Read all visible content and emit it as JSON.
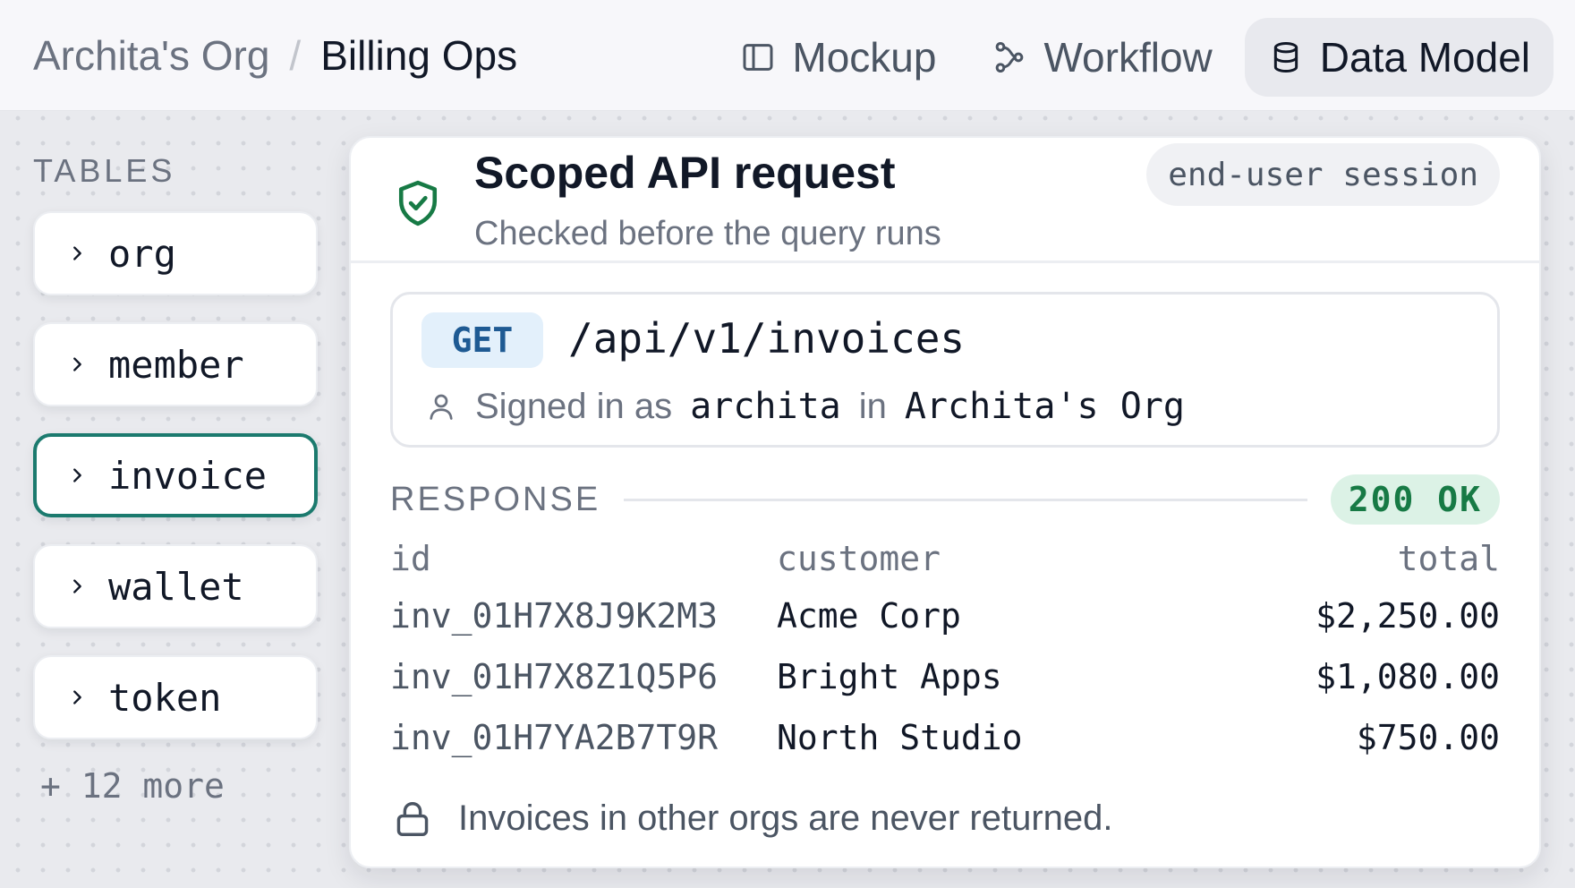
{
  "breadcrumb": {
    "org": "Archita's Org",
    "separator": "/",
    "project": "Billing Ops"
  },
  "nav": {
    "tabs": [
      {
        "label": "Mockup",
        "icon": "panel-icon",
        "active": false
      },
      {
        "label": "Workflow",
        "icon": "workflow-icon",
        "active": false
      },
      {
        "label": "Data Model",
        "icon": "database-icon",
        "active": true
      }
    ]
  },
  "sidebar": {
    "heading": "TABLES",
    "tables": [
      {
        "name": "org",
        "selected": false
      },
      {
        "name": "member",
        "selected": false
      },
      {
        "name": "invoice",
        "selected": true
      },
      {
        "name": "wallet",
        "selected": false
      },
      {
        "name": "token",
        "selected": false
      }
    ],
    "more": "+ 12 more"
  },
  "card": {
    "title": "Scoped API request",
    "subtitle": "Checked before the query runs",
    "session": "end-user session",
    "request": {
      "method": "GET",
      "path": "/api/v1/invoices",
      "signed_prefix": "Signed in as",
      "user": "archita",
      "in_word": "in",
      "org": "Archita's Org"
    },
    "response": {
      "label": "RESPONSE",
      "status": "200 OK",
      "columns": [
        "id",
        "customer",
        "total"
      ],
      "rows": [
        [
          "inv_01H7X8J9K2M3",
          "Acme Corp",
          "$2,250.00"
        ],
        [
          "inv_01H7X8Z1Q5P6",
          "Bright Apps",
          "$1,080.00"
        ],
        [
          "inv_01H7YA2B7T9R",
          "North Studio",
          "$750.00"
        ]
      ]
    },
    "footer_note": "Invoices in other orgs are never returned."
  },
  "colors": {
    "accent": "#1b7a6e",
    "status_ok_bg": "#dcf2e6",
    "status_ok_text": "#177a45",
    "method_bg": "#e3f0fb",
    "method_text": "#1e5a93"
  }
}
